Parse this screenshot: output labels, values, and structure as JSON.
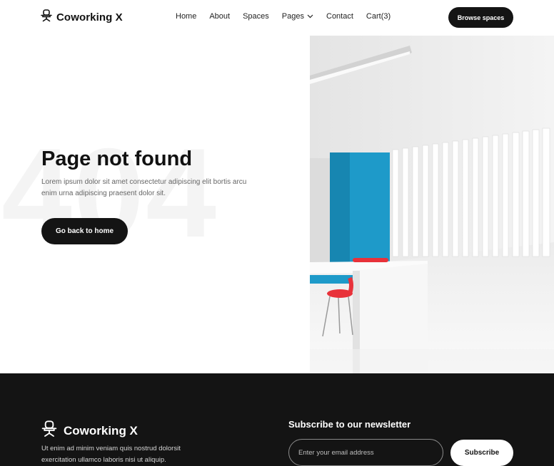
{
  "brand": {
    "name": "Coworking X",
    "icon": "office-chair-icon"
  },
  "nav": {
    "items": [
      {
        "label": "Home"
      },
      {
        "label": "About"
      },
      {
        "label": "Spaces"
      },
      {
        "label": "Pages",
        "icon": "chevron-down-icon"
      },
      {
        "label": "Contact"
      },
      {
        "label": "Cart(3)"
      }
    ],
    "cta_label": "Browse spaces"
  },
  "hero": {
    "bg_text": "404",
    "title": "Page not found",
    "description": "Lorem ipsum dolor sit amet consectetur adipiscing elit bortis arcu enim urna adipiscing praesent dolor sit.",
    "button_label": "Go back to home"
  },
  "footer": {
    "brand_name": "Coworking X",
    "description": "Ut enim ad minim veniam quis nostrud dolorsit exercitation ullamco laboris nisi ut aliquip.",
    "newsletter_title": "Subscribe to our newsletter",
    "email_placeholder": "Enter your email address",
    "subscribe_label": "Subscribe"
  },
  "colors": {
    "dark": "#141414",
    "accent_blue": "#1e9ac9",
    "accent_red": "#e8323a"
  }
}
